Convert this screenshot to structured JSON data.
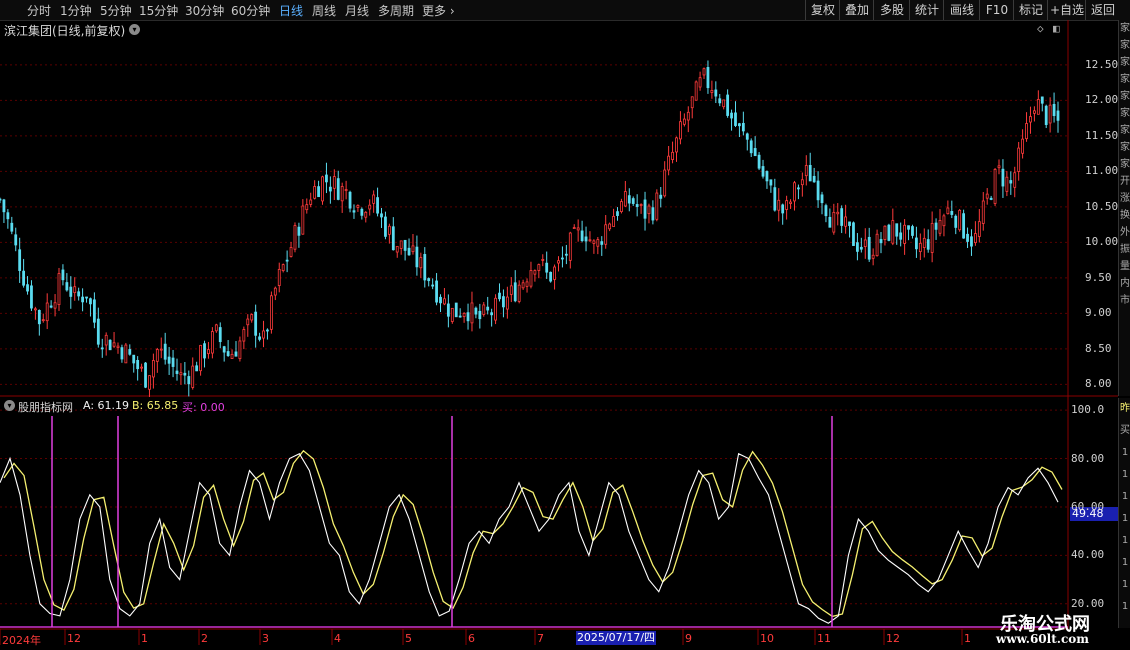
{
  "toolbar": {
    "periods": [
      "分时",
      "1分钟",
      "5分钟",
      "15分钟",
      "30分钟",
      "60分钟",
      "日线",
      "周线",
      "月线",
      "多周期",
      "更多"
    ],
    "active_period": "日线",
    "buttons": [
      "复权",
      "叠加",
      "多股",
      "统计",
      "画线",
      "F10",
      "标记",
      "+自选",
      "返回"
    ]
  },
  "stock": {
    "title": "滨江集团(日线,前复权)"
  },
  "indicator": {
    "name": "股朋指标网",
    "a_label": "A: 61.19",
    "b_label": "B: 65.85",
    "buy_label": "买: 0.00",
    "cursor_value": "49.48"
  },
  "price_axis": [
    "12.50",
    "12.00",
    "11.50",
    "11.00",
    "10.50",
    "10.00",
    "9.50",
    "9.00",
    "8.50",
    "8.00"
  ],
  "indicator_axis": [
    "100.0",
    "80.00",
    "60.00",
    "40.00",
    "20.00"
  ],
  "date_axis": [
    "2024年",
    "12",
    "1",
    "2",
    "3",
    "4",
    "5",
    "6",
    "7",
    "9",
    "10",
    "11",
    "12",
    "1"
  ],
  "cursor_date": "2025/07/17/四",
  "right_strip_top": [
    "家",
    "家",
    "家",
    "家",
    "家",
    "家",
    "家",
    "家",
    "家",
    "开",
    "涨",
    "换",
    "外",
    "振",
    "量",
    "内",
    "市"
  ],
  "right_strip_bottom": [
    "昨",
    "买",
    "1",
    "1",
    "1",
    "1",
    "1",
    "1",
    "1",
    "1"
  ],
  "watermark": {
    "cn": "乐淘公式网",
    "url": "www.60lt.com"
  },
  "colors": {
    "up": "#ff3b3b",
    "down": "#5bdcf0",
    "line_a": "#ffffff",
    "line_b": "#f5f070",
    "buy": "#e040e0",
    "grid": "#5a0000"
  },
  "chart_data": {
    "type": "candlestick",
    "price_ylim": [
      7.85,
      12.85
    ],
    "indicator_ylim": [
      10,
      105
    ],
    "price_path": [
      [
        0,
        10.6
      ],
      [
        5,
        10.3
      ],
      [
        10,
        9.9
      ],
      [
        18,
        9.3
      ],
      [
        25,
        8.9
      ],
      [
        32,
        9.2
      ],
      [
        40,
        9.5
      ],
      [
        48,
        9.2
      ],
      [
        55,
        9.3
      ],
      [
        62,
        8.7
      ],
      [
        70,
        8.6
      ],
      [
        78,
        8.5
      ],
      [
        85,
        8.3
      ],
      [
        92,
        8.1
      ],
      [
        100,
        8.5
      ],
      [
        107,
        8.3
      ],
      [
        115,
        8.1
      ],
      [
        122,
        8.2
      ],
      [
        130,
        8.5
      ],
      [
        137,
        8.7
      ],
      [
        145,
        8.4
      ],
      [
        152,
        8.6
      ],
      [
        160,
        8.9
      ],
      [
        167,
        8.6
      ],
      [
        175,
        9.4
      ],
      [
        182,
        9.8
      ],
      [
        190,
        10.3
      ],
      [
        197,
        10.7
      ],
      [
        205,
        10.9
      ],
      [
        212,
        10.8
      ],
      [
        220,
        10.7
      ],
      [
        227,
        10.5
      ],
      [
        235,
        10.6
      ],
      [
        242,
        10.3
      ],
      [
        250,
        10.0
      ],
      [
        257,
        9.9
      ],
      [
        265,
        9.7
      ],
      [
        272,
        9.5
      ],
      [
        280,
        9.2
      ],
      [
        287,
        9.0
      ],
      [
        295,
        9.1
      ],
      [
        302,
        8.9
      ],
      [
        310,
        9.0
      ],
      [
        317,
        9.1
      ],
      [
        325,
        9.3
      ],
      [
        332,
        9.5
      ],
      [
        340,
        9.8
      ],
      [
        347,
        9.5
      ],
      [
        355,
        9.7
      ],
      [
        362,
        10.0
      ],
      [
        370,
        10.2
      ],
      [
        377,
        9.9
      ],
      [
        385,
        10.3
      ],
      [
        392,
        10.5
      ],
      [
        400,
        10.6
      ],
      [
        407,
        10.4
      ],
      [
        415,
        10.5
      ],
      [
        422,
        11.0
      ],
      [
        430,
        11.5
      ],
      [
        437,
        11.9
      ],
      [
        445,
        12.3
      ],
      [
        452,
        12.2
      ],
      [
        460,
        11.9
      ],
      [
        467,
        11.6
      ],
      [
        475,
        11.4
      ],
      [
        482,
        11.0
      ],
      [
        490,
        10.6
      ],
      [
        497,
        10.4
      ],
      [
        505,
        10.8
      ],
      [
        512,
        11.0
      ],
      [
        520,
        10.7
      ],
      [
        527,
        10.3
      ],
      [
        535,
        10.2
      ],
      [
        542,
        10.0
      ],
      [
        550,
        9.9
      ],
      [
        557,
        10.0
      ],
      [
        565,
        10.2
      ],
      [
        572,
        10.1
      ],
      [
        580,
        9.9
      ],
      [
        587,
        10.0
      ],
      [
        595,
        10.3
      ],
      [
        602,
        10.5
      ],
      [
        610,
        10.2
      ],
      [
        617,
        10.0
      ],
      [
        625,
        10.6
      ],
      [
        632,
        11.0
      ],
      [
        640,
        10.8
      ],
      [
        647,
        11.3
      ],
      [
        655,
        12.0
      ],
      [
        662,
        11.8
      ],
      [
        670,
        11.7
      ]
    ],
    "line_a_path": [
      [
        0,
        70
      ],
      [
        5,
        80
      ],
      [
        10,
        65
      ],
      [
        15,
        40
      ],
      [
        20,
        20
      ],
      [
        25,
        16
      ],
      [
        30,
        15
      ],
      [
        35,
        30
      ],
      [
        40,
        55
      ],
      [
        45,
        65
      ],
      [
        50,
        60
      ],
      [
        55,
        30
      ],
      [
        60,
        18
      ],
      [
        65,
        15
      ],
      [
        70,
        20
      ],
      [
        75,
        45
      ],
      [
        80,
        55
      ],
      [
        85,
        35
      ],
      [
        90,
        30
      ],
      [
        95,
        50
      ],
      [
        100,
        70
      ],
      [
        105,
        65
      ],
      [
        110,
        45
      ],
      [
        115,
        40
      ],
      [
        120,
        60
      ],
      [
        125,
        75
      ],
      [
        130,
        70
      ],
      [
        135,
        55
      ],
      [
        140,
        70
      ],
      [
        145,
        80
      ],
      [
        150,
        82
      ],
      [
        155,
        75
      ],
      [
        160,
        60
      ],
      [
        165,
        45
      ],
      [
        170,
        40
      ],
      [
        175,
        25
      ],
      [
        180,
        20
      ],
      [
        185,
        30
      ],
      [
        190,
        45
      ],
      [
        195,
        60
      ],
      [
        200,
        65
      ],
      [
        205,
        55
      ],
      [
        210,
        40
      ],
      [
        215,
        25
      ],
      [
        220,
        15
      ],
      [
        225,
        17
      ],
      [
        230,
        30
      ],
      [
        235,
        45
      ],
      [
        240,
        50
      ],
      [
        245,
        45
      ],
      [
        250,
        55
      ],
      [
        255,
        60
      ],
      [
        260,
        70
      ],
      [
        265,
        60
      ],
      [
        270,
        50
      ],
      [
        275,
        55
      ],
      [
        280,
        65
      ],
      [
        285,
        70
      ],
      [
        290,
        50
      ],
      [
        295,
        40
      ],
      [
        300,
        55
      ],
      [
        305,
        70
      ],
      [
        310,
        65
      ],
      [
        315,
        50
      ],
      [
        320,
        40
      ],
      [
        325,
        30
      ],
      [
        330,
        25
      ],
      [
        335,
        35
      ],
      [
        340,
        50
      ],
      [
        345,
        65
      ],
      [
        350,
        75
      ],
      [
        355,
        70
      ],
      [
        360,
        55
      ],
      [
        365,
        60
      ],
      [
        370,
        82
      ],
      [
        375,
        80
      ],
      [
        380,
        72
      ],
      [
        385,
        65
      ],
      [
        390,
        50
      ],
      [
        395,
        35
      ],
      [
        400,
        20
      ],
      [
        405,
        18
      ],
      [
        410,
        14
      ],
      [
        415,
        12
      ],
      [
        420,
        15
      ],
      [
        425,
        40
      ],
      [
        430,
        55
      ],
      [
        435,
        50
      ],
      [
        440,
        42
      ],
      [
        445,
        38
      ],
      [
        450,
        35
      ],
      [
        455,
        32
      ],
      [
        460,
        28
      ],
      [
        465,
        25
      ],
      [
        470,
        30
      ],
      [
        475,
        40
      ],
      [
        480,
        50
      ],
      [
        485,
        42
      ],
      [
        490,
        35
      ],
      [
        495,
        45
      ],
      [
        500,
        60
      ],
      [
        505,
        68
      ],
      [
        510,
        65
      ],
      [
        515,
        72
      ],
      [
        520,
        76
      ],
      [
        525,
        70
      ],
      [
        530,
        62
      ]
    ],
    "buy_spikes_x": [
      52,
      118,
      452,
      832
    ]
  }
}
